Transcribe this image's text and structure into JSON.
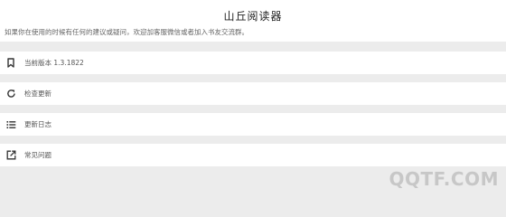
{
  "header": {
    "title": "山丘阅读器",
    "description": "如果你在使用的时候有任何的建议或疑问，欢迎加客服微信或者加入书友交流群。"
  },
  "menu": {
    "items": [
      {
        "icon": "bookmark-icon",
        "label": "当前版本 1.3.1822"
      },
      {
        "icon": "refresh-icon",
        "label": "检查更新"
      },
      {
        "icon": "list-icon",
        "label": "更新日志"
      },
      {
        "icon": "external-link-icon",
        "label": "常见问题"
      }
    ]
  },
  "watermark": {
    "text": "QQTF.COM"
  }
}
